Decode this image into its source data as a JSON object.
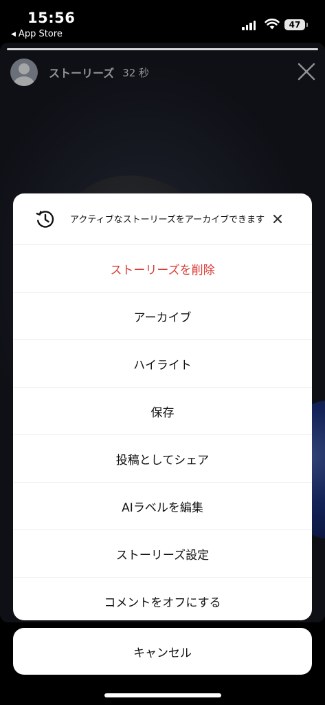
{
  "status_bar": {
    "time": "15:56",
    "back_app": "App Store",
    "battery": "47"
  },
  "story": {
    "user_name": "ストーリーズ",
    "elapsed": "32 秒"
  },
  "sheet": {
    "header_text": "アクティブなストーリーズをアーカイブできます",
    "items": [
      {
        "label": "ストーリーズを削除",
        "destructive": true
      },
      {
        "label": "アーカイブ"
      },
      {
        "label": "ハイライト"
      },
      {
        "label": "保存"
      },
      {
        "label": "投稿としてシェア"
      },
      {
        "label": "AIラベルを編集"
      },
      {
        "label": "ストーリーズ設定"
      },
      {
        "label": "コメントをオフにする"
      }
    ]
  },
  "cancel_label": "キャンセル",
  "colors": {
    "destructive": "#d83a34",
    "sheet_background": "#ffffff"
  }
}
